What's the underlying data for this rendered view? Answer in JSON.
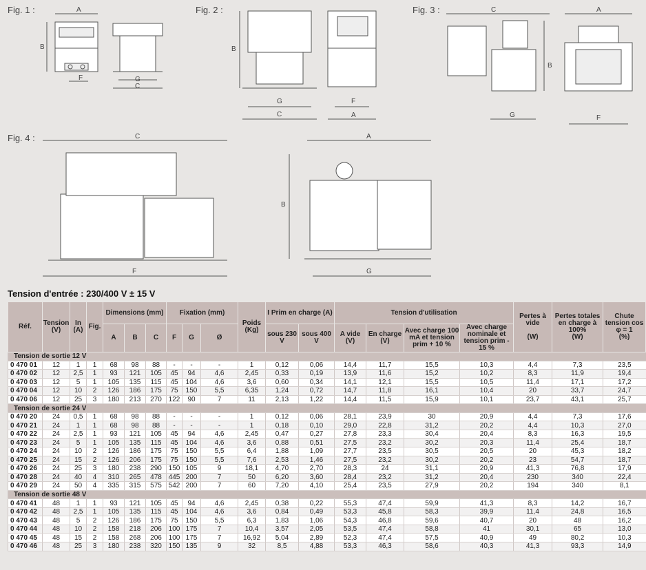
{
  "fig_labels": [
    "Fig. 1 :",
    "Fig. 2 :",
    "Fig. 3 :",
    "Fig. 4 :"
  ],
  "dim_letters": {
    "A": "A",
    "B": "B",
    "C": "C",
    "F": "F",
    "G": "G"
  },
  "title": "Tension d'entrée : 230/400 V ± 15 V",
  "header": {
    "ref": "Réf.",
    "tension": "Tension (V)",
    "in": "In (A)",
    "fig": "Fig.",
    "dimensions": "Dimensions (mm)",
    "fixation": "Fixation (mm)",
    "poids": "Poids (Kg)",
    "iprim": "I Prim en charge (A)",
    "tension_util": "Tension d'utilisation",
    "pertes_vide": "Pertes à vide",
    "pertes_totales": "Pertes totales en charge à 100%",
    "chute": "Chute tension cos φ = 1",
    "sub_A": "A",
    "sub_B": "B",
    "sub_C": "C",
    "sub_F": "F",
    "sub_G": "G",
    "sub_diam": "Ø",
    "sous230": "sous 230 V",
    "sous400": "sous 400 V",
    "avide": "A vide (V)",
    "encharge": "En charge (V)",
    "avec100": "Avec charge 100 mA et tension prim + 10 %",
    "avecnom": "Avec charge nominale et tension prim - 15 %",
    "unit_W1": "(W)",
    "unit_W2": "(W)",
    "unit_pct": "(%)"
  },
  "sections": [
    {
      "label": "Tension de sortie 12 V",
      "rows": [
        [
          "0 470 01",
          "12",
          "1",
          "1",
          "68",
          "98",
          "88",
          "-",
          "-",
          "-",
          "1",
          "0,12",
          "0,06",
          "14,4",
          "11,7",
          "15,5",
          "10,3",
          "4,4",
          "7,3",
          "23,5"
        ],
        [
          "0 470 02",
          "12",
          "2,5",
          "1",
          "93",
          "121",
          "105",
          "45",
          "94",
          "4,6",
          "2,45",
          "0,33",
          "0,19",
          "13,9",
          "11,6",
          "15,2",
          "10,2",
          "8,3",
          "11,9",
          "19,4"
        ],
        [
          "0 470 03",
          "12",
          "5",
          "1",
          "105",
          "135",
          "115",
          "45",
          "104",
          "4,6",
          "3,6",
          "0,60",
          "0,34",
          "14,1",
          "12,1",
          "15,5",
          "10,5",
          "11,4",
          "17,1",
          "17,2"
        ],
        [
          "0 470 04",
          "12",
          "10",
          "2",
          "126",
          "186",
          "175",
          "75",
          "150",
          "5,5",
          "6,35",
          "1,24",
          "0,72",
          "14,7",
          "11,8",
          "16,1",
          "10,4",
          "20",
          "33,7",
          "24,7"
        ],
        [
          "0 470 06",
          "12",
          "25",
          "3",
          "180",
          "213",
          "270",
          "122",
          "90",
          "7",
          "11",
          "2,13",
          "1,22",
          "14,4",
          "11,5",
          "15,9",
          "10,1",
          "23,7",
          "43,1",
          "25,7"
        ]
      ]
    },
    {
      "label": "Tension de sortie 24 V",
      "rows": [
        [
          "0 470 20",
          "24",
          "0,5",
          "1",
          "68",
          "98",
          "88",
          "-",
          "-",
          "-",
          "1",
          "0,12",
          "0,06",
          "28,1",
          "23,9",
          "30",
          "20,9",
          "4,4",
          "7,3",
          "17,6"
        ],
        [
          "0 470 21",
          "24",
          "1",
          "1",
          "68",
          "98",
          "88",
          "-",
          "-",
          "-",
          "1",
          "0,18",
          "0,10",
          "29,0",
          "22,8",
          "31,2",
          "20,2",
          "4,4",
          "10,3",
          "27,0"
        ],
        [
          "0 470 22",
          "24",
          "2,5",
          "1",
          "93",
          "121",
          "105",
          "45",
          "94",
          "4,6",
          "2,45",
          "0,47",
          "0,27",
          "27,8",
          "23,3",
          "30,4",
          "20,4",
          "8,3",
          "16,3",
          "19,5"
        ],
        [
          "0 470 23",
          "24",
          "5",
          "1",
          "105",
          "135",
          "115",
          "45",
          "104",
          "4,6",
          "3,6",
          "0,88",
          "0,51",
          "27,5",
          "23,2",
          "30,2",
          "20,3",
          "11,4",
          "25,4",
          "18,7"
        ],
        [
          "0 470 24",
          "24",
          "10",
          "2",
          "126",
          "186",
          "175",
          "75",
          "150",
          "5,5",
          "6,4",
          "1,88",
          "1,09",
          "27,7",
          "23,5",
          "30,5",
          "20,5",
          "20",
          "45,3",
          "18,2"
        ],
        [
          "0 470 25",
          "24",
          "15",
          "2",
          "126",
          "206",
          "175",
          "75",
          "150",
          "5,5",
          "7,6",
          "2,53",
          "1,46",
          "27,5",
          "23,2",
          "30,2",
          "20,2",
          "23",
          "54,7",
          "18,7"
        ],
        [
          "0 470 26",
          "24",
          "25",
          "3",
          "180",
          "238",
          "290",
          "150",
          "105",
          "9",
          "18,1",
          "4,70",
          "2,70",
          "28,3",
          "24",
          "31,1",
          "20,9",
          "41,3",
          "76,8",
          "17,9"
        ],
        [
          "0 470 28",
          "24",
          "40",
          "4",
          "310",
          "265",
          "478",
          "445",
          "200",
          "7",
          "50",
          "6,20",
          "3,60",
          "28,4",
          "23,2",
          "31,2",
          "20,4",
          "230",
          "340",
          "22,4"
        ],
        [
          "0 470 29",
          "24",
          "50",
          "4",
          "335",
          "315",
          "575",
          "542",
          "200",
          "7",
          "60",
          "7,20",
          "4,10",
          "25,4",
          "23,5",
          "27,9",
          "20,2",
          "194",
          "340",
          "8,1"
        ]
      ]
    },
    {
      "label": "Tension de sortie 48 V",
      "rows": [
        [
          "0 470 41",
          "48",
          "1",
          "1",
          "93",
          "121",
          "105",
          "45",
          "94",
          "4,6",
          "2,45",
          "0,38",
          "0,22",
          "55,3",
          "47,4",
          "59,9",
          "41,3",
          "8,3",
          "14,2",
          "16,7"
        ],
        [
          "0 470 42",
          "48",
          "2,5",
          "1",
          "105",
          "135",
          "115",
          "45",
          "104",
          "4,6",
          "3,6",
          "0,84",
          "0,49",
          "53,3",
          "45,8",
          "58,3",
          "39,9",
          "11,4",
          "24,8",
          "16,5"
        ],
        [
          "0 470 43",
          "48",
          "5",
          "2",
          "126",
          "186",
          "175",
          "75",
          "150",
          "5,5",
          "6,3",
          "1,83",
          "1,06",
          "54,3",
          "46,8",
          "59,6",
          "40,7",
          "20",
          "48",
          "16,2"
        ],
        [
          "0 470 44",
          "48",
          "10",
          "2",
          "158",
          "218",
          "206",
          "100",
          "175",
          "7",
          "10,4",
          "3,57",
          "2,05",
          "53,5",
          "47,4",
          "58,8",
          "41",
          "30,1",
          "65",
          "13,0"
        ],
        [
          "0 470 45",
          "48",
          "15",
          "2",
          "158",
          "268",
          "206",
          "100",
          "175",
          "7",
          "16,92",
          "5,04",
          "2,89",
          "52,3",
          "47,4",
          "57,5",
          "40,9",
          "49",
          "80,2",
          "10,3"
        ],
        [
          "0 470 46",
          "48",
          "25",
          "3",
          "180",
          "238",
          "320",
          "150",
          "135",
          "9",
          "32",
          "8,5",
          "4,88",
          "53,3",
          "46,3",
          "58,6",
          "40,3",
          "41,3",
          "93,3",
          "14,9"
        ]
      ]
    }
  ]
}
